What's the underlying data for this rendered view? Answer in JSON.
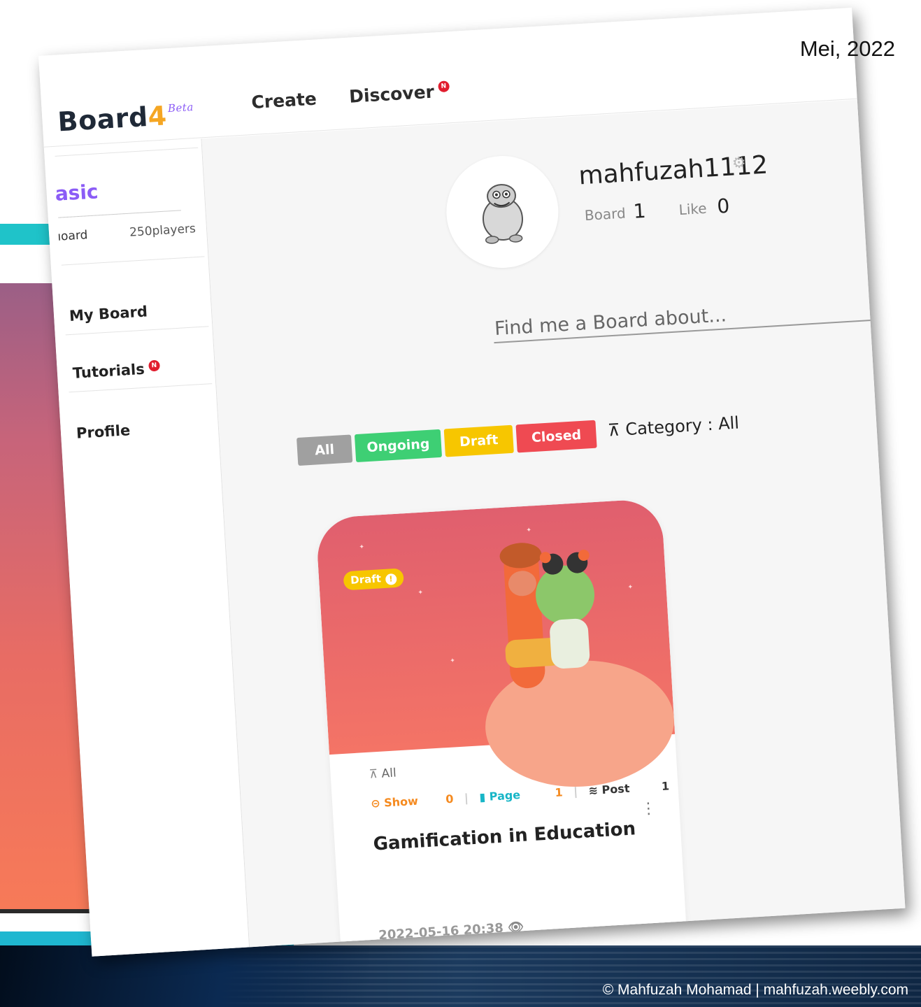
{
  "slide": {
    "date": "Mei, 2022",
    "copyright": "© Mahfuzah Mohamad | mahfuzah.weebly.com"
  },
  "app": {
    "logo": "Board",
    "logo_four": "4",
    "logo_badge": "Beta",
    "nav": {
      "create": "Create",
      "discover": "Discover"
    },
    "new_badge": "N"
  },
  "sidebar": {
    "plan_name": "asic",
    "plan_board": "ıoard",
    "plan_players": "250players",
    "items": [
      {
        "label": "My Board"
      },
      {
        "label": "Tutorials"
      },
      {
        "label": "Profile"
      }
    ]
  },
  "profile": {
    "username": "mahfuzah1112",
    "board_label": "Board",
    "board_count": "1",
    "like_label": "Like",
    "like_count": "0"
  },
  "search": {
    "placeholder": "Find me a Board about..."
  },
  "filters": {
    "chips": [
      {
        "label": "All",
        "color": "#a0a0a0"
      },
      {
        "label": "Ongoing",
        "color": "#3ecf74"
      },
      {
        "label": "Draft",
        "color": "#f7c600"
      },
      {
        "label": "Closed",
        "color": "#ef4a52"
      }
    ],
    "category": "Category : All"
  },
  "card": {
    "status": "Draft",
    "category": "All",
    "show_label": "Show",
    "show_count": "0",
    "page_label": "Page",
    "page_count": "1",
    "post_label": "Post",
    "post_count": "1",
    "title": "Gamification in Education",
    "date": "2022-05-16 20:38"
  }
}
